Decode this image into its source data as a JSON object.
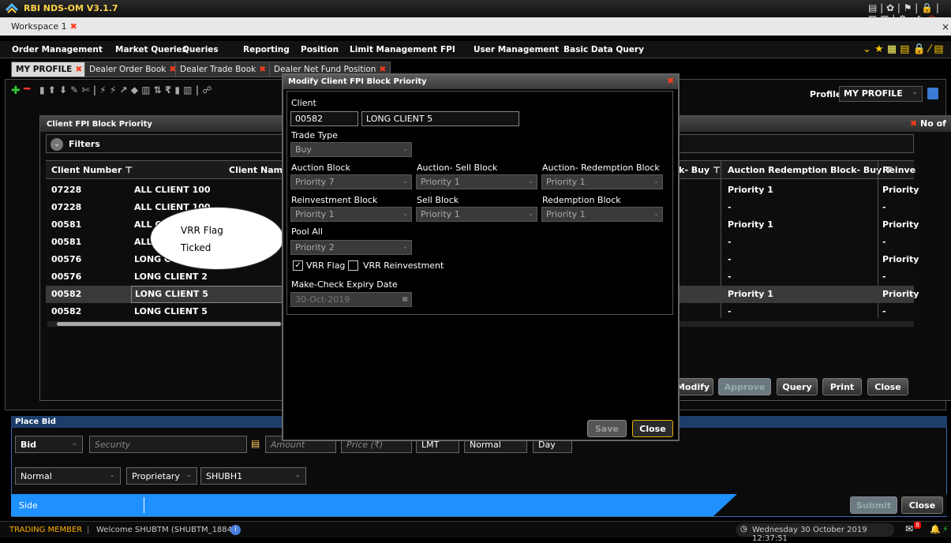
{
  "app": {
    "title": "RBI NDS-OM V3.1.7",
    "workspace_tab": "Workspace 1"
  },
  "menu": [
    "Order Management",
    "Market Queries",
    "Queries",
    "Reporting",
    "Position",
    "Limit Management",
    "FPI",
    "User Management",
    "Basic Data Query"
  ],
  "tabs": [
    "MY PROFILE",
    "Dealer Order Book",
    "Dealer Trade Book",
    "Dealer Net Fund Position"
  ],
  "profile": {
    "label": "Profile",
    "value": "MY PROFILE"
  },
  "fpi": {
    "title": "Client FPI Block Priority",
    "filters": "Filters",
    "no_of": "No of",
    "cols_left": [
      "Client Number",
      "Client Name"
    ],
    "cols_right": [
      "k- Buy",
      "Auction Redemption Block- Buy",
      "Reinve"
    ],
    "rows": [
      {
        "num": "07228",
        "name": "ALL CLIENT 100",
        "r1": "Priority 1",
        "r2": "Priority"
      },
      {
        "num": "07228",
        "name": "ALL CLIENT 100",
        "r1": "-",
        "r2": "-"
      },
      {
        "num": "00581",
        "name": "ALL C",
        "r1": "Priority 1",
        "r2": "Priority"
      },
      {
        "num": "00581",
        "name": "ALL",
        "r1": "-",
        "r2": "-"
      },
      {
        "num": "00576",
        "name": "LONG C",
        "r1": "-",
        "r2": "Priority"
      },
      {
        "num": "00576",
        "name": "LONG CLIENT 2",
        "r1": "-",
        "r2": "-"
      },
      {
        "num": "00582",
        "name": "LONG CLIENT 5",
        "r1": "Priority 1",
        "r2": "Priority"
      },
      {
        "num": "00582",
        "name": "LONG CLIENT 5",
        "r1": "-",
        "r2": "-"
      }
    ],
    "buttons": {
      "modify": "Modify",
      "approve": "Approve",
      "query": "Query",
      "print": "Print",
      "close": "Close"
    }
  },
  "modal": {
    "title": "Modify Client FPI Block Priority",
    "client_label": "Client",
    "client_code": "00582",
    "client_name": "LONG CLIENT 5",
    "trade_type_label": "Trade Type",
    "trade_type": "Buy",
    "auction_block_label": "Auction Block",
    "auction_block": "Priority 7",
    "auction_sell_label": "Auction- Sell Block",
    "auction_sell": "Priority 1",
    "auction_red_label": "Auction- Redemption Block",
    "auction_red": "Priority 1",
    "reinv_label": "Reinvestment Block",
    "reinv": "Priority 1",
    "sell_label": "Sell Block",
    "sell": "Priority 1",
    "red_label": "Redemption Block",
    "red": "Priority 1",
    "pool_label": "Pool All",
    "pool": "Priority 2",
    "vrr_flag": "VRR Flag",
    "vrr_reinv": "VRR Reinvestment",
    "expiry_label": "Make-Check Expiry Date",
    "expiry": "30-Oct-2019",
    "save": "Save",
    "close": "Close"
  },
  "callout": {
    "line1": "VRR Flag",
    "line2": "Ticked"
  },
  "placebid": {
    "title": "Place Bid",
    "side": "Bid",
    "security_ph": "Security",
    "amount_ph": "Amount",
    "price_ph": "Price (₹)",
    "lmt": "LMT",
    "normal": "Normal",
    "day": "Day",
    "normal2": "Normal",
    "proprietary": "Proprietary",
    "user": "SHUBH1",
    "side_label": "Side",
    "submit": "Submit",
    "close": "Close"
  },
  "status": {
    "member": "TRADING MEMBER",
    "welcome": "Welcome SHUBTM (SHUBTM_1884)",
    "datetime": "Wednesday 30 October 2019 12:37:51",
    "badge": "8"
  }
}
